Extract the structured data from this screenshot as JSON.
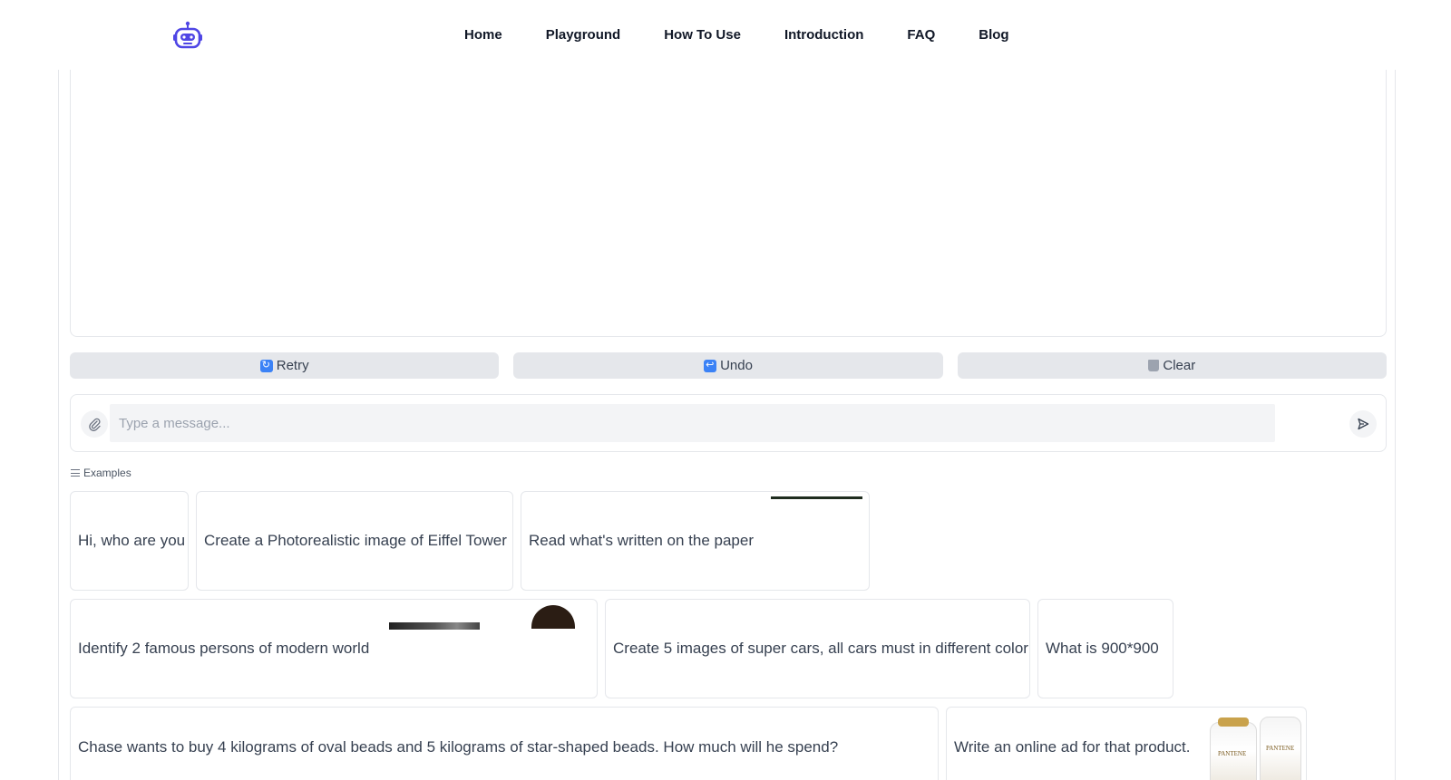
{
  "navbar": {
    "logo_icon": "robot-icon",
    "links": [
      "Home",
      "Playground",
      "How To Use",
      "Introduction",
      "FAQ",
      "Blog"
    ]
  },
  "actions": {
    "retry_label": "Retry",
    "undo_label": "Undo",
    "clear_label": "Clear",
    "retry_icon": "retry-icon",
    "undo_icon": "undo-icon",
    "clear_icon": "trash-icon"
  },
  "composer": {
    "placeholder": "Type a message...",
    "value": "",
    "attach_icon": "paperclip-icon",
    "send_icon": "send-icon"
  },
  "examples": {
    "label": "Examples",
    "items": [
      "Hi, who are you",
      "Create a Photorealistic image of Eiffel Tower",
      "Read what's written on the paper",
      "Identify 2 famous persons of modern world",
      "Create 5 images of super cars, all cars must in different color",
      "What is 900*900",
      "Chase wants to buy 4 kilograms of oval beads and 5 kilograms of star-shaped beads. How much will he spend?",
      "Write an online ad for that product."
    ],
    "product_brand": "PANTENE"
  },
  "colors": {
    "accent": "#4f46e5",
    "button_bg": "#e5e7eb",
    "input_bg": "#f3f4f6",
    "border": "#e5e7eb"
  }
}
